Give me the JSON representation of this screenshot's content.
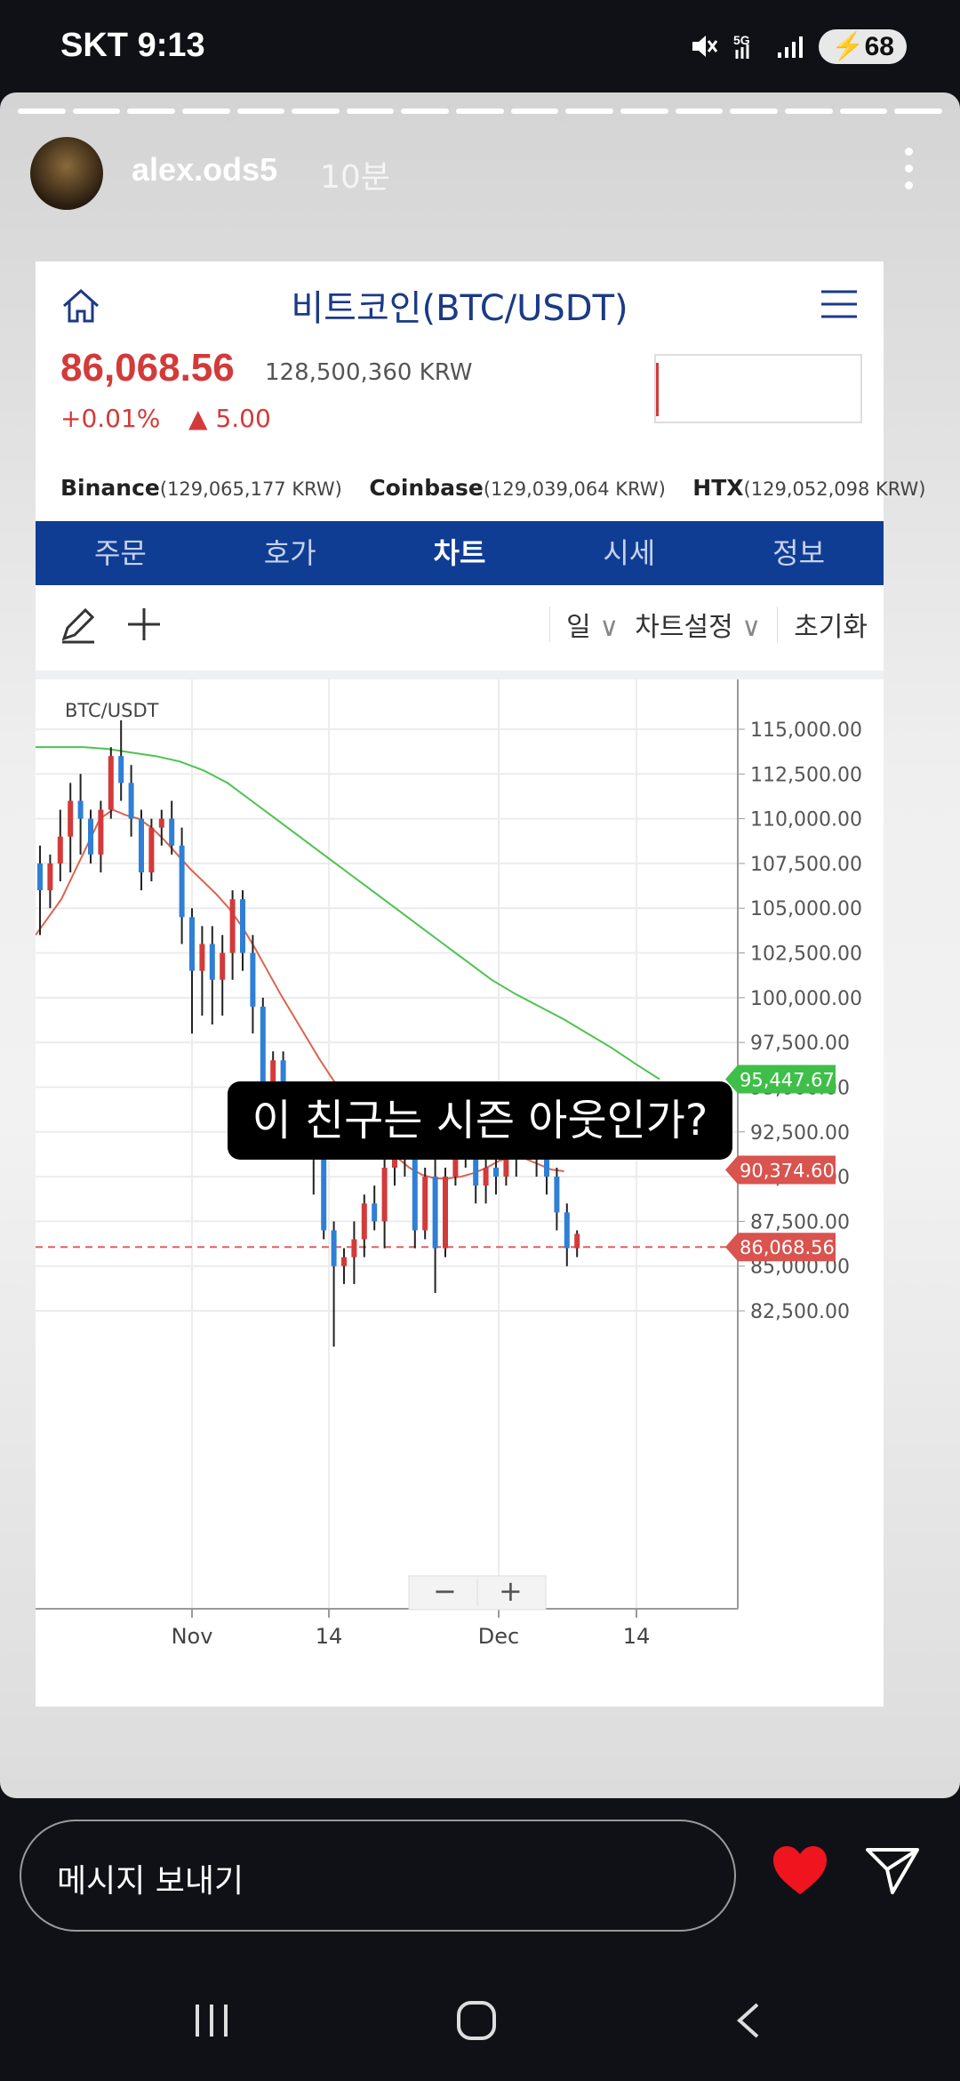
{
  "status": {
    "carrier": "SKT",
    "time": "9:13",
    "battery": "68"
  },
  "story": {
    "username": "alex.ods5",
    "time_ago": "10분",
    "caption": "이 친구는 시즌 아웃인가?"
  },
  "app": {
    "title": "비트코인(BTC/USDT)",
    "price": "86,068.56",
    "price_krw": "128,500,360 KRW",
    "change_pct": "+0.01%",
    "change_abs": "5.00",
    "exchanges": [
      {
        "name": "Binance",
        "value": "(129,065,177 KRW)"
      },
      {
        "name": "Coinbase",
        "value": "(129,039,064 KRW)"
      },
      {
        "name": "HTX",
        "value": "(129,052,098 KRW)"
      }
    ],
    "tabs": [
      "주문",
      "호가",
      "차트",
      "시세",
      "정보"
    ],
    "active_tab": "차트",
    "toolbar": {
      "period": "일",
      "settings": "차트설정",
      "reset": "초기화"
    },
    "colors": {
      "up": "#d33a3a",
      "down": "#2f7fd6",
      "brand": "#103d94"
    }
  },
  "chart_data": {
    "type": "candlestick",
    "title": "BTC/USDT",
    "x_ticks": [
      "Nov",
      "14",
      "Dec",
      "14"
    ],
    "y_ticks": [
      "115,000.00",
      "112,500.00",
      "110,000.00",
      "107,500.00",
      "105,000.00",
      "102,500.00",
      "100,000.00",
      "97,500.00",
      "95,000.00",
      "92,500.00",
      "90,000.00",
      "87,500.00",
      "85,000.00",
      "82,500.00"
    ],
    "ylim": [
      80000,
      117000
    ],
    "price_tags": [
      {
        "label": "95,447.67",
        "value": 95447.67,
        "color": "#3fbf4a"
      },
      {
        "label": "90,374.60",
        "value": 90374.6,
        "color": "#d9534f"
      },
      {
        "label": "86,068.56",
        "value": 86068.56,
        "color": "#d9534f"
      }
    ],
    "candles": [
      [
        107500,
        108500,
        103500,
        106000
      ],
      [
        106000,
        108000,
        105000,
        107500
      ],
      [
        107500,
        110500,
        106500,
        109000
      ],
      [
        109000,
        112000,
        107000,
        111000
      ],
      [
        111000,
        112500,
        108000,
        110000
      ],
      [
        110000,
        110500,
        107500,
        108000
      ],
      [
        108000,
        111000,
        107000,
        110500
      ],
      [
        110500,
        114000,
        110000,
        113500
      ],
      [
        113500,
        115500,
        111000,
        112000
      ],
      [
        112000,
        113000,
        109000,
        110000
      ],
      [
        110000,
        110500,
        106000,
        107000
      ],
      [
        107000,
        110000,
        106500,
        109500
      ],
      [
        109500,
        110500,
        108500,
        110000
      ],
      [
        110000,
        111000,
        108000,
        108500
      ],
      [
        108500,
        109500,
        103000,
        104500
      ],
      [
        104500,
        105000,
        98000,
        101500
      ],
      [
        101500,
        104000,
        99000,
        103000
      ],
      [
        103000,
        104000,
        98500,
        101000
      ],
      [
        101000,
        103500,
        99000,
        102500
      ],
      [
        102500,
        106000,
        101000,
        105500
      ],
      [
        105500,
        106000,
        101500,
        102500
      ],
      [
        102500,
        103500,
        98000,
        99500
      ],
      [
        99500,
        100000,
        94000,
        95000
      ],
      [
        95000,
        97000,
        94000,
        96500
      ],
      [
        96500,
        97000,
        93500,
        94000
      ],
      [
        94000,
        94500,
        91500,
        92500
      ],
      [
        92500,
        94500,
        91000,
        93500
      ],
      [
        93500,
        93500,
        89000,
        91000
      ],
      [
        91000,
        91500,
        86500,
        87000
      ],
      [
        87000,
        87500,
        80500,
        85000
      ],
      [
        85000,
        86000,
        84000,
        85500
      ],
      [
        85500,
        87500,
        84000,
        86500
      ],
      [
        86500,
        89000,
        85500,
        88500
      ],
      [
        88500,
        89500,
        87000,
        87500
      ],
      [
        87500,
        91000,
        86000,
        90500
      ],
      [
        90500,
        92500,
        89500,
        91500
      ],
      [
        91500,
        92500,
        90000,
        91000
      ],
      [
        91000,
        91500,
        86000,
        87000
      ],
      [
        87000,
        90500,
        86500,
        90000
      ],
      [
        90000,
        91500,
        83500,
        86000
      ],
      [
        86000,
        90500,
        85500,
        90000
      ],
      [
        90000,
        94000,
        89500,
        93000
      ],
      [
        93000,
        93500,
        90500,
        92000
      ],
      [
        92000,
        92500,
        88500,
        89500
      ],
      [
        89500,
        91000,
        88500,
        90500
      ],
      [
        90500,
        91500,
        89000,
        90000
      ],
      [
        90000,
        92000,
        89500,
        91000
      ],
      [
        91000,
        94000,
        90000,
        93000
      ],
      [
        93000,
        93500,
        91500,
        92500
      ],
      [
        92500,
        93500,
        90000,
        91500
      ],
      [
        91500,
        92500,
        89000,
        90000
      ],
      [
        90000,
        90500,
        87000,
        88000
      ],
      [
        88000,
        88500,
        85000,
        86000
      ],
      [
        86000,
        87000,
        85500,
        86800
      ]
    ],
    "ma_red": [
      103500,
      104500,
      105500,
      107000,
      108500,
      110000,
      110500,
      110200,
      110000,
      109500,
      108800,
      108000,
      107200,
      106500,
      105800,
      105000,
      104000,
      102800,
      101500,
      100200,
      99000,
      97800,
      96600,
      95500,
      94500,
      93500,
      92600,
      91800,
      91100,
      90500,
      90100,
      89900,
      89900,
      90000,
      90200,
      90500,
      90900,
      91100,
      91000,
      90700,
      90400,
      90300
    ],
    "ma_green": [
      114000,
      114000,
      114000,
      113900,
      113700,
      113500,
      113200,
      112700,
      112000,
      111000,
      110000,
      109000,
      108000,
      107000,
      106000,
      105000,
      104000,
      103000,
      102000,
      101000,
      100200,
      99500,
      98800,
      98000,
      97200,
      96300,
      95447
    ],
    "annotation": "이 친구는 시즌 아웃인가?"
  },
  "bottom": {
    "message_placeholder": "메시지 보내기"
  },
  "icons": [
    "home-icon",
    "menu-icon",
    "pencil-icon",
    "plus-icon",
    "chevron-down-icon",
    "heart-icon",
    "send-icon",
    "back-icon"
  ]
}
